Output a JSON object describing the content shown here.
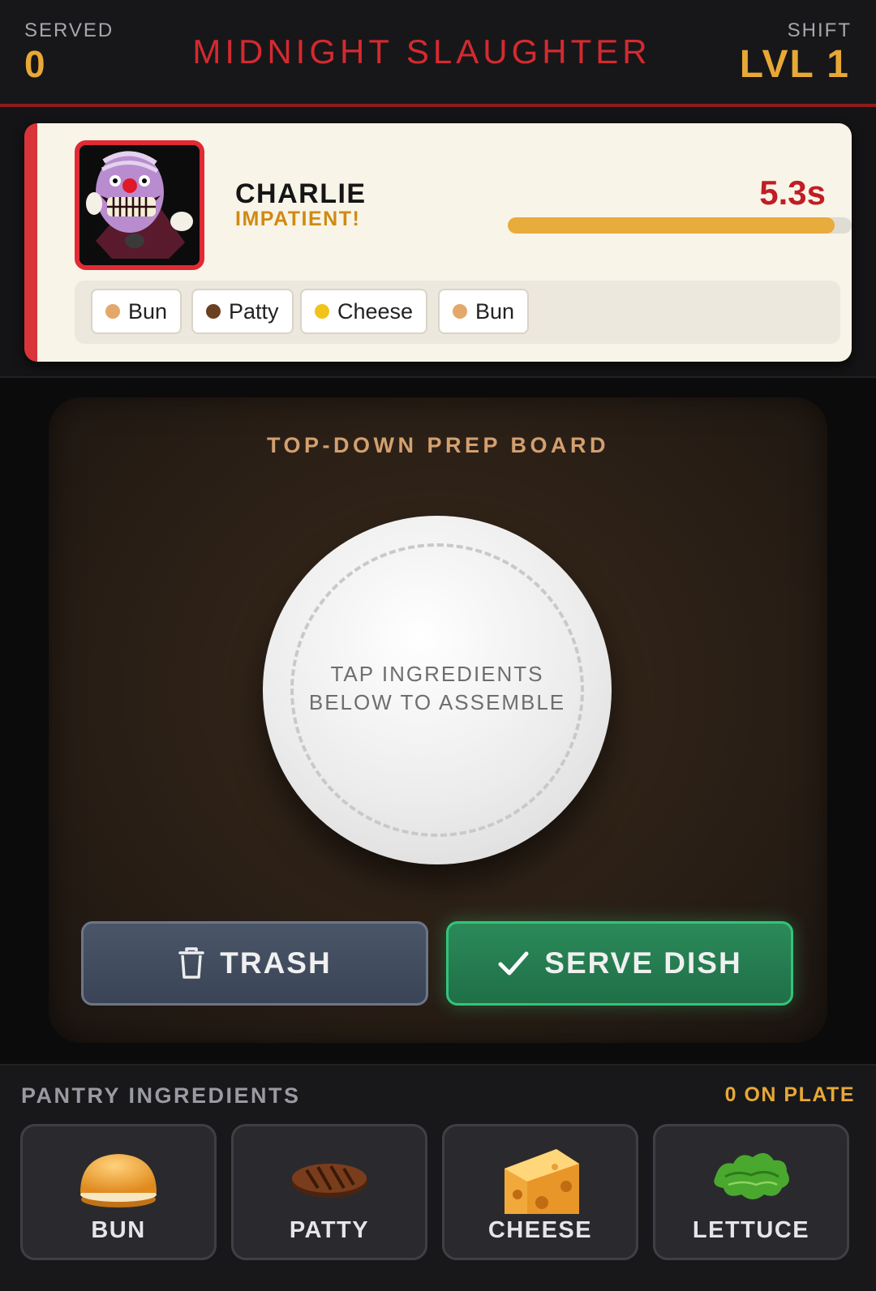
{
  "header": {
    "served_label": "SERVED",
    "served_value": "0",
    "title": "MIDNIGHT SLAUGHTER",
    "shift_label": "SHIFT",
    "shift_value": "LVL 1"
  },
  "order": {
    "customer_name": "CHARLIE",
    "mood": "IMPATIENT!",
    "timer": "5.3s",
    "patience_fraction": 0.95,
    "recipe": [
      {
        "label": "Bun",
        "color": "#e3a86a"
      },
      {
        "label": "Patty",
        "color": "#6b3f22"
      },
      {
        "label": "Cheese",
        "color": "#f2c318"
      },
      {
        "label": "Bun",
        "color": "#e3a86a"
      }
    ]
  },
  "board": {
    "title": "TOP-DOWN PREP BOARD",
    "plate_hint": "TAP INGREDIENTS\nBELOW TO ASSEMBLE",
    "trash_label": "TRASH",
    "serve_label": "SERVE DISH"
  },
  "pantry": {
    "title": "PANTRY INGREDIENTS",
    "plate_count": "0 ON PLATE",
    "items": [
      {
        "label": "BUN",
        "icon": "bun-icon"
      },
      {
        "label": "PATTY",
        "icon": "patty-icon"
      },
      {
        "label": "CHEESE",
        "icon": "cheese-icon"
      },
      {
        "label": "LETTUCE",
        "icon": "lettuce-icon"
      }
    ]
  },
  "colors": {
    "accent_red": "#d42a2f",
    "accent_gold": "#e8a835",
    "serve_green": "#2b8a5a"
  }
}
